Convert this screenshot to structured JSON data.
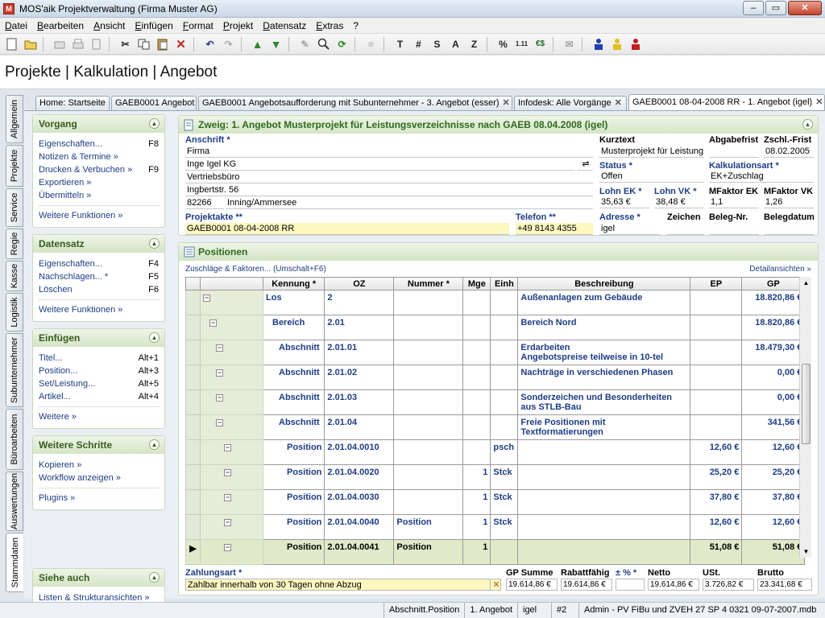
{
  "window": {
    "title": "MOS'aik Projektverwaltung (Firma Muster AG)",
    "minimize": "–",
    "maximize": "▭",
    "close": "✕"
  },
  "menu": [
    "Datei",
    "Bearbeiten",
    "Ansicht",
    "Einfügen",
    "Format",
    "Projekt",
    "Datensatz",
    "Extras",
    "?"
  ],
  "toolbar": {
    "t": "T",
    "hash": "#",
    "s": "S",
    "a": "A",
    "z": "Z",
    "percent": "%",
    "num": "1.11",
    "euro": "€$"
  },
  "page_heading": "Projekte | Kalkulation | Angebot",
  "side_tabs": [
    "Allgemein",
    "Projekte",
    "Service",
    "Regie",
    "Kasse",
    "Logistik",
    "Subunternehmer",
    "Büroarbeiten",
    "Auswertungen",
    "Stammdaten"
  ],
  "tabs": [
    {
      "label": "Home: Startseite"
    },
    {
      "label": "GAEB0001 Angebot"
    },
    {
      "label": "GAEB0001 Angebotsaufforderung mit Subunternehmer - 3. Angebot (esser)"
    },
    {
      "label": "Infodesk: Alle Vorgänge"
    },
    {
      "label": "GAEB0001 08-04-2008 RR - 1. Angebot (igel)"
    }
  ],
  "tab_close": "✕",
  "left": {
    "vorgang": {
      "title": "Vorgang",
      "items": [
        {
          "label": "Eigenschaften...",
          "key": "F8"
        },
        {
          "label": "Notizen & Termine »",
          "key": ""
        },
        {
          "label": "Drucken & Verbuchen »",
          "key": "F9"
        },
        {
          "label": "Exportieren »",
          "key": ""
        },
        {
          "label": "Übermitteln »",
          "key": ""
        }
      ],
      "more": "Weitere Funktionen »"
    },
    "datensatz": {
      "title": "Datensatz",
      "items": [
        {
          "label": "Eigenschaften...",
          "key": "F4"
        },
        {
          "label": "Nachschlagen... *",
          "key": "F5"
        },
        {
          "label": "Löschen",
          "key": "F6"
        }
      ],
      "more": "Weitere Funktionen »"
    },
    "einfuegen": {
      "title": "Einfügen",
      "items": [
        {
          "label": "Titel...",
          "key": "Alt+1"
        },
        {
          "label": "Position...",
          "key": "Alt+3"
        },
        {
          "label": "Set/Leistung...",
          "key": "Alt+5"
        },
        {
          "label": "Artikel...",
          "key": "Alt+4"
        }
      ],
      "more": "Weitere »"
    },
    "schritte": {
      "title": "Weitere Schritte",
      "items": [
        {
          "label": "Kopieren »",
          "key": ""
        },
        {
          "label": "Workflow anzeigen »",
          "key": ""
        }
      ],
      "more": "Plugins »"
    },
    "siehe": {
      "title": "Siehe auch",
      "items": [
        {
          "label": "Listen & Strukturansichten »",
          "key": ""
        }
      ]
    }
  },
  "zweig": {
    "title": "Zweig: 1. Angebot Musterprojekt für Leistungsverzeichnisse nach GAEB 08.04.2008 (igel)",
    "anschrift_label": "Anschrift *",
    "anschrift": [
      "Firma",
      "Inge Igel KG",
      "Vertriebsbüro",
      "Ingbertstr. 56"
    ],
    "plz": "82266",
    "ort": "Inning/Ammersee",
    "kurztext_label": "Kurztext",
    "kurztext": "Musterprojekt für Leistung",
    "abgabefrist_label": "Abgabefrist",
    "abgabefrist": "",
    "zschl_label": "Zschl.-Frist",
    "zschl": "08.02.2005",
    "status_label": "Status *",
    "status": "Offen",
    "kalk_label": "Kalkulationsart *",
    "kalk": "EK+Zuschlag",
    "lohnek_label": "Lohn EK *",
    "lohnek": "35,63 €",
    "lohnvk_label": "Lohn VK *",
    "lohnvk": "38,48 €",
    "mfek_label": "MFaktor EK",
    "mfek": "1,1",
    "mfvk_label": "MFaktor VK",
    "mfvk": "1,26",
    "projektakte_label": "Projektakte **",
    "projektakte": "GAEB0001 08-04-2008 RR",
    "telefon_label": "Telefon **",
    "telefon": "+49 8143 4355",
    "adresse_label": "Adresse *",
    "adresse": "igel",
    "zeichen_label": "Zeichen",
    "zeichen": "",
    "belegnr_label": "Beleg-Nr.",
    "belegnr": "",
    "belegdatum_label": "Belegdatum",
    "belegdatum": ""
  },
  "positionen": {
    "title": "Positionen",
    "link_left": "Zuschläge & Faktoren... (Umschalt+F6)",
    "link_right": "Detailansichten »",
    "columns": [
      "Kennung *",
      "OZ",
      "Nummer *",
      "Mge",
      "Einh",
      "Beschreibung",
      "EP",
      "GP"
    ],
    "rows": [
      {
        "level": 0,
        "kennung": "Los",
        "oz": "2",
        "nummer": "",
        "mge": "",
        "einh": "",
        "b1": "Außenanlagen zum Gebäude",
        "b2": "",
        "ep": "",
        "gp": "18.820,86 €"
      },
      {
        "level": 1,
        "kennung": "Bereich",
        "oz": "2.01",
        "nummer": "",
        "mge": "",
        "einh": "",
        "b1": "Bereich Nord",
        "b2": "",
        "ep": "",
        "gp": "18.820,86 €"
      },
      {
        "level": 2,
        "kennung": "Abschnitt",
        "oz": "2.01.01",
        "nummer": "",
        "mge": "",
        "einh": "",
        "b1": "Erdarbeiten",
        "b2": "Angebotspreise teilweise in 10-tel",
        "ep": "",
        "gp": "18.479,30 €"
      },
      {
        "level": 2,
        "kennung": "Abschnitt",
        "oz": "2.01.02",
        "nummer": "",
        "mge": "",
        "einh": "",
        "b1": "Nachträge in verschiedenen Phasen",
        "b2": "",
        "ep": "",
        "gp": "0,00 €"
      },
      {
        "level": 2,
        "kennung": "Abschnitt",
        "oz": "2.01.03",
        "nummer": "",
        "mge": "",
        "einh": "",
        "b1": "Sonderzeichen und Besonderheiten",
        "b2": "aus STLB-Bau",
        "ep": "",
        "gp": "0,00 €"
      },
      {
        "level": 2,
        "kennung": "Abschnitt",
        "oz": "2.01.04",
        "nummer": "",
        "mge": "",
        "einh": "",
        "b1": "Freie Positionen mit",
        "b2": "Textformatierungen",
        "ep": "",
        "gp": "341,56 €"
      },
      {
        "level": 3,
        "kennung": "Position",
        "oz": "2.01.04.0010",
        "nummer": "",
        "mge": "",
        "einh": "psch",
        "b1": "",
        "b2": "",
        "ep": "12,60 €",
        "gp": "12,60 €"
      },
      {
        "level": 3,
        "kennung": "Position",
        "oz": "2.01.04.0020",
        "nummer": "",
        "mge": "1",
        "einh": "Stck",
        "b1": "",
        "b2": "",
        "ep": "25,20 €",
        "gp": "25,20 €"
      },
      {
        "level": 3,
        "kennung": "Position",
        "oz": "2.01.04.0030",
        "nummer": "",
        "mge": "1",
        "einh": "Stck",
        "b1": "",
        "b2": "",
        "ep": "37,80 €",
        "gp": "37,80 €"
      },
      {
        "level": 3,
        "kennung": "Position",
        "oz": "2.01.04.0040",
        "nummer": "Position",
        "mge": "1",
        "einh": "Stck",
        "b1": "",
        "b2": "",
        "ep": "12,60 €",
        "gp": "12,60 €"
      },
      {
        "level": 3,
        "kennung": "Position",
        "oz": "2.01.04.0041",
        "nummer": "Position",
        "mge": "1",
        "einh": "",
        "b1": "",
        "b2": "",
        "ep": "51,08 €",
        "gp": "51,08 €",
        "selected": true
      }
    ],
    "zahlungsart_label": "Zahlungsart *",
    "zahlungsart": "Zahlbar innerhalb von 30 Tagen ohne Abzug",
    "sums": [
      {
        "label": "GP Summe",
        "value": "19.614,86 €"
      },
      {
        "label": "Rabattfähig",
        "value": "19.614,86 €"
      },
      {
        "label": "± % *",
        "value": ""
      },
      {
        "label": "Netto",
        "value": "19.614,86 €"
      },
      {
        "label": "USt.",
        "value": "3.726,82 €"
      },
      {
        "label": "Brutto",
        "value": "23.341,68 €"
      }
    ]
  },
  "status": [
    "Abschnitt.Position",
    "1. Angebot",
    "igel",
    "#2",
    "Admin - PV FiBu und ZVEH 27 SP 4 0321 09-07-2007.mdb"
  ]
}
